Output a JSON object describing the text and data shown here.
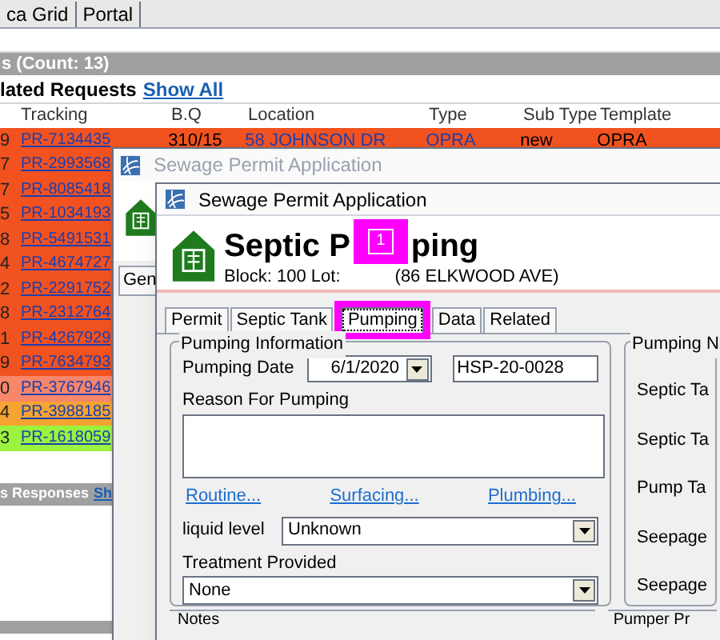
{
  "bg_tabs": [
    "ca Grid",
    "Portal"
  ],
  "count_bar": "s (Count: 13)",
  "related": {
    "title": "lated Requests",
    "link": "Show All"
  },
  "columns": [
    "Tracking",
    "B.Q",
    "Location",
    "Type",
    "Sub Type",
    "Template"
  ],
  "rows": [
    {
      "num": "9",
      "tracking": "PR-7134435",
      "bq": "310/15",
      "location": "58 JOHNSON DR",
      "type": "OPRA",
      "sub_type": "new",
      "template": "OPRA",
      "color": "#f2521f"
    },
    {
      "num": "7",
      "tracking": "PR-2993568",
      "color": "#f2521f"
    },
    {
      "num": "7",
      "tracking": "PR-8085418",
      "color": "#f2521f"
    },
    {
      "num": "5",
      "tracking": "PR-1034193",
      "color": "#f2521f"
    },
    {
      "num": "8",
      "tracking": "PR-5491531",
      "color": "#f2521f"
    },
    {
      "num": "4",
      "tracking": "PR-4674727",
      "color": "#f2521f"
    },
    {
      "num": "2",
      "tracking": "PR-2291752",
      "color": "#f2521f"
    },
    {
      "num": "8",
      "tracking": "PR-2312764",
      "color": "#f2521f"
    },
    {
      "num": "1",
      "tracking": "PR-4267929",
      "color": "#f2521f"
    },
    {
      "num": "9",
      "tracking": "PR-7634793",
      "color": "#f2521f"
    },
    {
      "num": "0",
      "tracking": "PR-3767946",
      "color": "#f7866a"
    },
    {
      "num": "4",
      "tracking": "PR-3988185",
      "color": "#f5a431"
    },
    {
      "num": "3",
      "tracking": "PR-1618059",
      "color": "#9bf23f"
    }
  ],
  "responses": {
    "title": "s Responses",
    "link": "Sh"
  },
  "back_window": {
    "title": "Sewage Permit Application",
    "tab": "Gen"
  },
  "window": {
    "title": "Sewage Permit Application",
    "heading": [
      "Septic P",
      "ping"
    ],
    "block": "Block: 100 Lot:",
    "address": "(86 ELKWOOD AVE)",
    "callout": "1",
    "tabs": [
      {
        "label": "Permit",
        "selected": false
      },
      {
        "label": "Septic Tank",
        "selected": false
      },
      {
        "label": "Pumping",
        "selected": true
      },
      {
        "label": "Data",
        "selected": false
      },
      {
        "label": "Related",
        "selected": false
      }
    ],
    "pumping_info": {
      "legend": "Pumping Information",
      "date_label": "Pumping Date",
      "date": "6/1/2020",
      "number": "HSP-20-0028",
      "reason_label": "Reason For Pumping",
      "links": [
        "Routine...",
        "Surfacing...",
        "Plumbing..."
      ],
      "liquid_label": "liquid level",
      "liquid": "Unknown",
      "treatment_label": "Treatment Provided",
      "treatment": "None"
    },
    "notes_legend": "Notes",
    "right_group": {
      "legend": "Pumping N",
      "labels": [
        "Septic Ta",
        "Septic Ta",
        "Pump Ta",
        "Seepage",
        "Seepage"
      ]
    },
    "pumper_legend": "Pumper Pr"
  }
}
